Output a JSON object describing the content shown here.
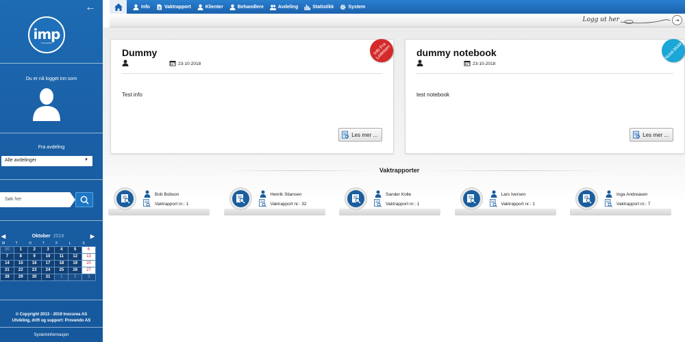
{
  "sidebar": {
    "logo_text": "imp",
    "logo_sub": "Inocurea",
    "logged_in_label": "Du er nå logget inn som",
    "department_label": "Fra avdeling",
    "department_value": "Alle avdelinger",
    "search_placeholder": "Søk her",
    "calendar": {
      "month": "Oktober",
      "year": "2019",
      "weekdays": [
        "M",
        "T",
        "O",
        "T",
        "F",
        "L",
        "S"
      ],
      "weeks": [
        [
          "30",
          "1",
          "2",
          "3",
          "4",
          "5",
          "6"
        ],
        [
          "7",
          "8",
          "9",
          "10",
          "11",
          "12",
          "13"
        ],
        [
          "14",
          "15",
          "16",
          "17",
          "18",
          "19",
          "20"
        ],
        [
          "21",
          "22",
          "23",
          "24",
          "25",
          "26",
          "27"
        ],
        [
          "28",
          "29",
          "30",
          "31",
          "1",
          "2",
          "3"
        ]
      ]
    },
    "copyright_line1": "© Copyright 2013 - 2019 Inocurea AS",
    "copyright_line2": "Utvikling, drift og support: Provendo AS",
    "system_info": "Systeminformasjon"
  },
  "nav": {
    "items": [
      "Info",
      "Vaktrapport",
      "Klienter",
      "Behandlere",
      "Avdeling",
      "Statistikk",
      "System"
    ]
  },
  "logout_label": "Logg ut her",
  "cards": [
    {
      "title": "Dummy",
      "date": "23-10-2018",
      "body": "Test info",
      "button_label": "Les mer ...",
      "badge_label": "Info Fra Ledelsen",
      "badge_color": "#d42a2a"
    },
    {
      "title": "dummy notebook",
      "date": "23-10-2018",
      "body": "test notebook",
      "button_label": "Les mer ...",
      "badge_label": "Notat-blokk",
      "badge_color": "#1aa6d6"
    }
  ],
  "vaktrapporter": {
    "title": "Vaktrapporter",
    "items": [
      {
        "name": "Bob Bobson",
        "count": "Vaktrapport nr.: 1"
      },
      {
        "name": "Henrik Stiansen",
        "count": "Vaktrapport nr.: 32"
      },
      {
        "name": "Sander Kolle",
        "count": "Vaktrapport nr.: 1"
      },
      {
        "name": "Lars Iversen",
        "count": "Vaktrapport nr.: 1"
      },
      {
        "name": "Inga Andreasen",
        "count": "Vaktrapport nr.: 7"
      }
    ]
  },
  "colors": {
    "sidebar_blue": "#1a5fa5",
    "nav_blue": "#1b62ad",
    "calendar_dark": "#113f73",
    "sunday_red": "#c81e1e"
  }
}
